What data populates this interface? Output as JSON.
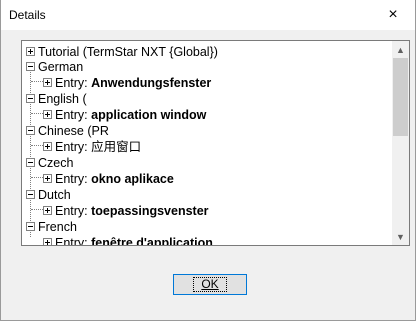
{
  "window": {
    "title": "Details",
    "close_symbol": "×"
  },
  "tree": {
    "items": [
      {
        "prefix": "Tutorial (TermStar NXT {Global})",
        "bold": ""
      },
      {
        "prefix": "German",
        "bold": ""
      },
      {
        "prefix": "Entry: ",
        "bold": "Anwendungsfenster"
      },
      {
        "prefix": "English (",
        "bold": ""
      },
      {
        "prefix": "Entry: ",
        "bold": "application window"
      },
      {
        "prefix": "Chinese (PR",
        "bold": ""
      },
      {
        "prefix": "Entry: ",
        "bold": "应用窗口"
      },
      {
        "prefix": "Czech",
        "bold": ""
      },
      {
        "prefix": "Entry: ",
        "bold": "okno aplikace"
      },
      {
        "prefix": "Dutch",
        "bold": ""
      },
      {
        "prefix": "Entry: ",
        "bold": "toepassingsvenster"
      },
      {
        "prefix": "French",
        "bold": ""
      },
      {
        "prefix": "Entry: ",
        "bold": "fenêtre d'application"
      }
    ]
  },
  "scrollbar": {
    "up_icon": "▲",
    "down_icon": "▼"
  },
  "buttons": {
    "ok_label": "OK"
  }
}
